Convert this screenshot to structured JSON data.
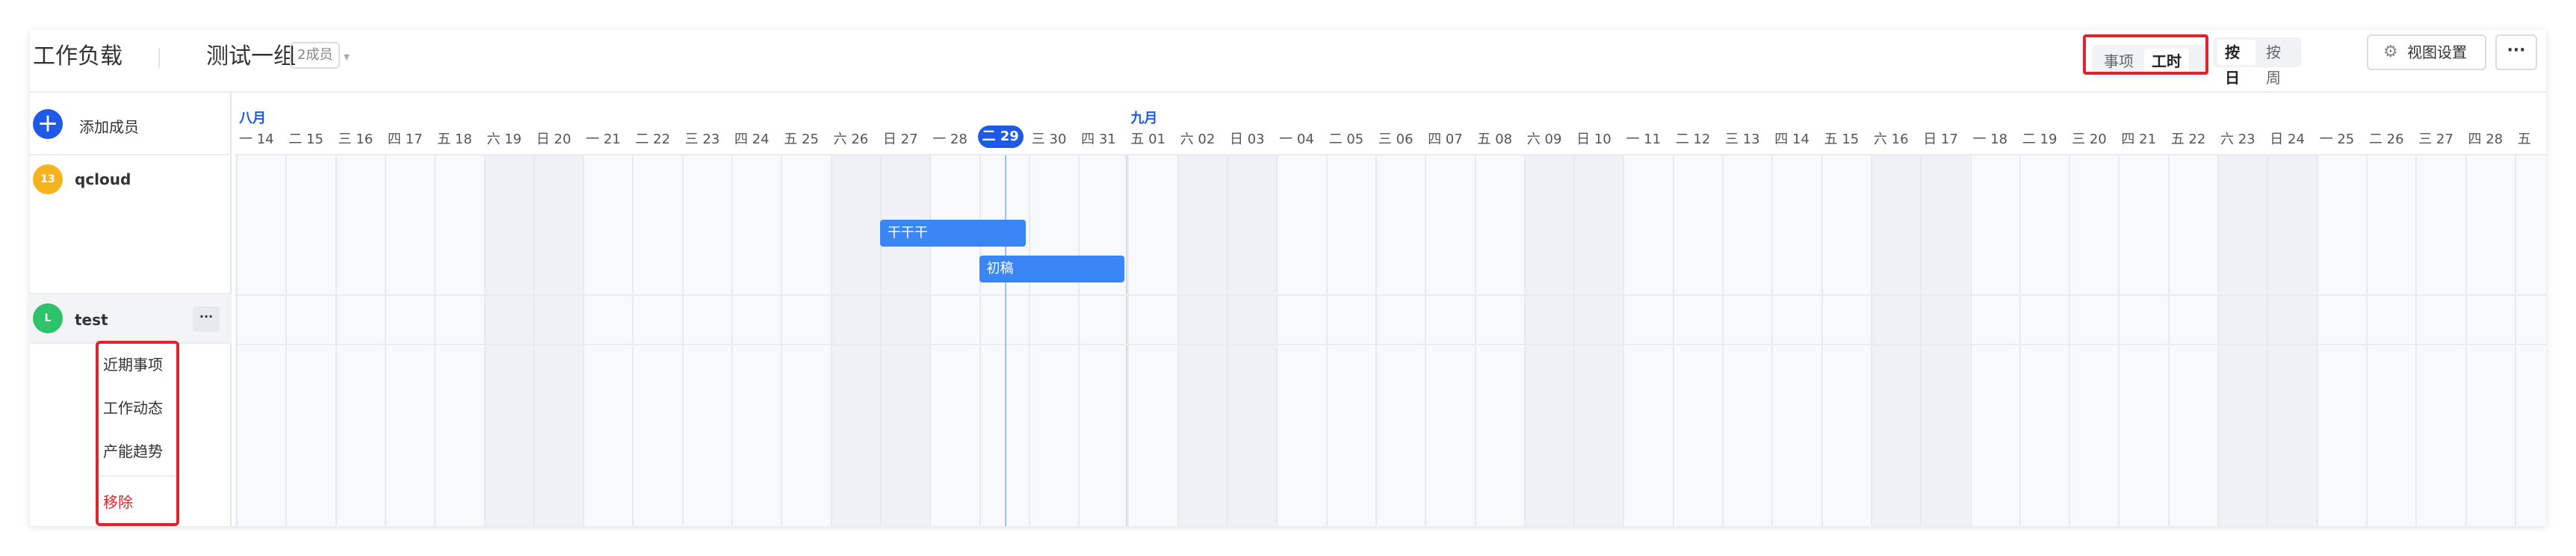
{
  "header": {
    "title": "工作负载",
    "group_name": "测试一组",
    "member_badge": "2成员",
    "view_type": {
      "options": [
        "事项",
        "工时"
      ],
      "selected": "工时"
    },
    "scale": {
      "options": [
        "按日",
        "按周"
      ],
      "selected": "按日"
    },
    "view_settings_label": "视图设置",
    "more_label": "···"
  },
  "sidebar": {
    "add_member_label": "添加成员",
    "members": [
      {
        "name": "qcloud",
        "avatar_text": "13",
        "avatar_color": "#f5b31e"
      },
      {
        "name": "test",
        "avatar_text": "L",
        "avatar_color": "#2cc36b"
      }
    ],
    "row_more_label": "···",
    "context_menu": {
      "items": [
        "近期事项",
        "工作动态",
        "产能趋势"
      ],
      "danger_item": "移除",
      "danger_color": "#e0242e"
    }
  },
  "timeline": {
    "months": [
      {
        "label": "八月"
      },
      {
        "label": "九月"
      }
    ],
    "days": [
      {
        "wd": "一",
        "d": "14"
      },
      {
        "wd": "二",
        "d": "15"
      },
      {
        "wd": "三",
        "d": "16"
      },
      {
        "wd": "四",
        "d": "17"
      },
      {
        "wd": "五",
        "d": "18"
      },
      {
        "wd": "六",
        "d": "19"
      },
      {
        "wd": "日",
        "d": "20"
      },
      {
        "wd": "一",
        "d": "21"
      },
      {
        "wd": "二",
        "d": "22"
      },
      {
        "wd": "三",
        "d": "23"
      },
      {
        "wd": "四",
        "d": "24"
      },
      {
        "wd": "五",
        "d": "25"
      },
      {
        "wd": "六",
        "d": "26"
      },
      {
        "wd": "日",
        "d": "27"
      },
      {
        "wd": "一",
        "d": "28"
      },
      {
        "wd": "二",
        "d": "29",
        "today": true
      },
      {
        "wd": "三",
        "d": "30"
      },
      {
        "wd": "四",
        "d": "31"
      },
      {
        "wd": "五",
        "d": "01"
      },
      {
        "wd": "六",
        "d": "02"
      },
      {
        "wd": "日",
        "d": "03"
      },
      {
        "wd": "一",
        "d": "04"
      },
      {
        "wd": "二",
        "d": "05"
      },
      {
        "wd": "三",
        "d": "06"
      },
      {
        "wd": "四",
        "d": "07"
      },
      {
        "wd": "五",
        "d": "08"
      },
      {
        "wd": "六",
        "d": "09"
      },
      {
        "wd": "日",
        "d": "10"
      },
      {
        "wd": "一",
        "d": "11"
      },
      {
        "wd": "二",
        "d": "12"
      },
      {
        "wd": "三",
        "d": "13"
      },
      {
        "wd": "四",
        "d": "14"
      },
      {
        "wd": "五",
        "d": "15"
      },
      {
        "wd": "六",
        "d": "16"
      },
      {
        "wd": "日",
        "d": "17"
      },
      {
        "wd": "一",
        "d": "18"
      },
      {
        "wd": "二",
        "d": "19"
      },
      {
        "wd": "三",
        "d": "20"
      },
      {
        "wd": "四",
        "d": "21"
      },
      {
        "wd": "五",
        "d": "22"
      },
      {
        "wd": "六",
        "d": "23"
      },
      {
        "wd": "日",
        "d": "24"
      },
      {
        "wd": "一",
        "d": "25"
      },
      {
        "wd": "二",
        "d": "26"
      },
      {
        "wd": "三",
        "d": "27"
      },
      {
        "wd": "四",
        "d": "28"
      },
      {
        "wd": "五",
        "d": ""
      }
    ],
    "tasks": [
      {
        "label": "干干干",
        "member": "qcloud",
        "start": "08-27",
        "end": "08-29"
      },
      {
        "label": "初稿",
        "member": "qcloud",
        "start": "08-29",
        "end": "08-31"
      }
    ],
    "accent_color": "#1e5ae6",
    "task_color": "#3a86f7"
  }
}
